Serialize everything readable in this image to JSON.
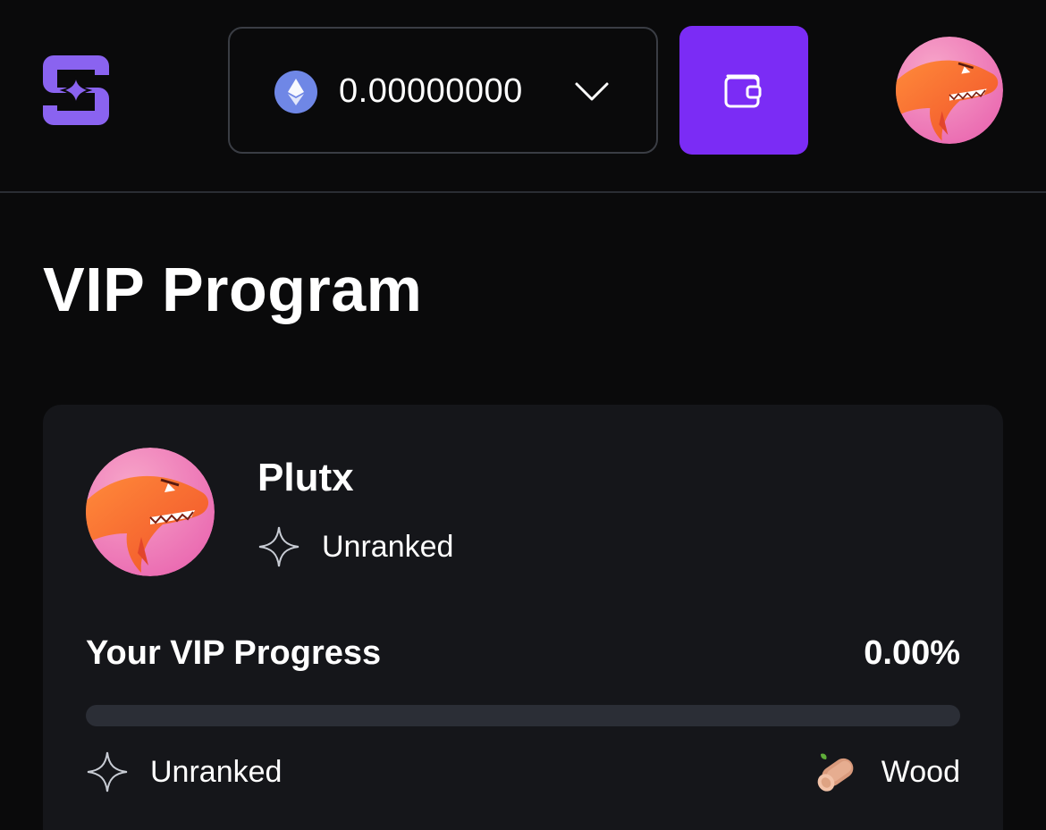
{
  "header": {
    "logo_icon": "brand-logo-icon",
    "balance": {
      "currency_icon": "ethereum-icon",
      "value": "0.00000000",
      "dropdown_icon": "chevron-down-icon"
    },
    "wallet_button_icon": "wallet-icon",
    "accent_color": "#7b2cf5"
  },
  "page": {
    "title": "VIP Program"
  },
  "vip_card": {
    "username": "Plutx",
    "current_rank": "Unranked",
    "progress_label": "Your VIP Progress",
    "progress_value": "0.00%",
    "progress_fraction": 0.0,
    "tier_from": "Unranked",
    "tier_to": "Wood",
    "tier_from_icon": "star-outline-icon",
    "tier_to_icon": "wood-log-icon"
  }
}
